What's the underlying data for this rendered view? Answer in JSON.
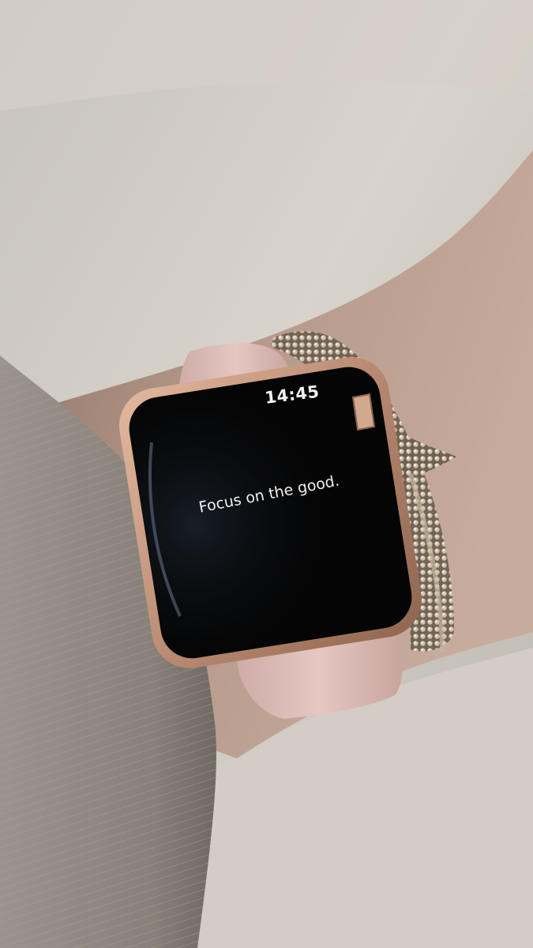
{
  "watch": {
    "time": "14:45",
    "message": "Focus on the good."
  },
  "colors": {
    "band": "#e2c2be",
    "case": "#c99a82",
    "screen": "#050505",
    "bracelet": "#a98f73",
    "sleeve": "#8f8a84",
    "skin": "#b69a8c",
    "background": "#cfcac3"
  }
}
